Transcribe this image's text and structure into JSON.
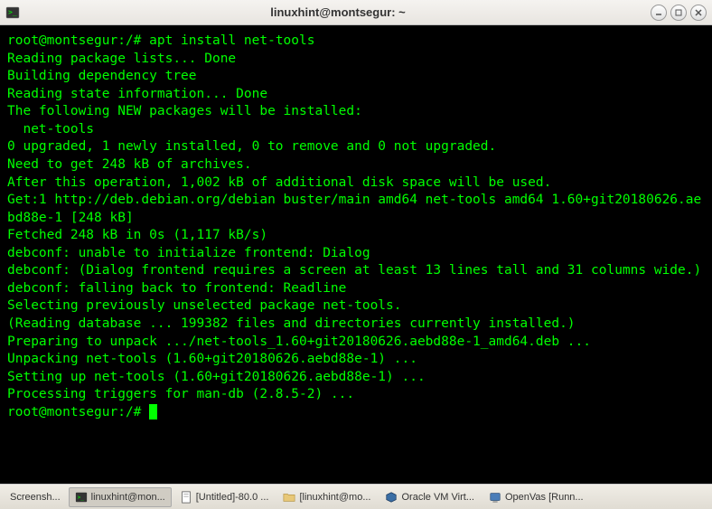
{
  "window": {
    "title": "linuxhint@montsegur: ~"
  },
  "terminal": {
    "prompt1": "root@montsegur:/# ",
    "command1": "apt install net-tools",
    "lines": [
      "Reading package lists... Done",
      "Building dependency tree",
      "Reading state information... Done",
      "The following NEW packages will be installed:",
      "  net-tools",
      "0 upgraded, 1 newly installed, 0 to remove and 0 not upgraded.",
      "Need to get 248 kB of archives.",
      "After this operation, 1,002 kB of additional disk space will be used.",
      "Get:1 http://deb.debian.org/debian buster/main amd64 net-tools amd64 1.60+git20180626.aebd88e-1 [248 kB]",
      "Fetched 248 kB in 0s (1,117 kB/s)",
      "debconf: unable to initialize frontend: Dialog",
      "debconf: (Dialog frontend requires a screen at least 13 lines tall and 31 columns wide.)",
      "debconf: falling back to frontend: Readline",
      "Selecting previously unselected package net-tools.",
      "(Reading database ... 199382 files and directories currently installed.)",
      "Preparing to unpack .../net-tools_1.60+git20180626.aebd88e-1_amd64.deb ...",
      "Unpacking net-tools (1.60+git20180626.aebd88e-1) ...",
      "Setting up net-tools (1.60+git20180626.aebd88e-1) ...",
      "Processing triggers for man-db (2.8.5-2) ..."
    ],
    "prompt2": "root@montsegur:/#"
  },
  "taskbar": {
    "items": [
      {
        "label": "Screensh..."
      },
      {
        "label": "linuxhint@mon...",
        "active": true
      },
      {
        "label": "[Untitled]-80.0 ..."
      },
      {
        "label": "[linuxhint@mo..."
      },
      {
        "label": "Oracle VM Virt..."
      },
      {
        "label": "OpenVas [Runn..."
      }
    ]
  }
}
